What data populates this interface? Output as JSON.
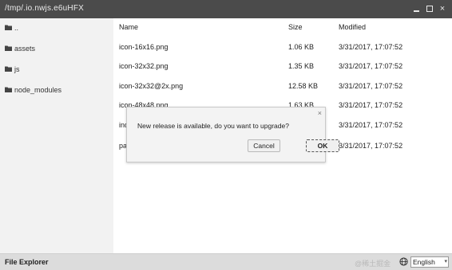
{
  "window": {
    "title": "/tmp/.io.nwjs.e6uHFX",
    "minimize_label": "",
    "maximize_label": "",
    "close_label": "×"
  },
  "sidebar": {
    "items": [
      {
        "label": ".."
      },
      {
        "label": "assets"
      },
      {
        "label": "js"
      },
      {
        "label": "node_modules"
      }
    ]
  },
  "table": {
    "columns": {
      "name": "Name",
      "size": "Size",
      "modified": "Modified"
    },
    "rows": [
      {
        "name": "icon-16x16.png",
        "size": "1.06 KB",
        "modified": "3/31/2017, 17:07:52"
      },
      {
        "name": "icon-32x32.png",
        "size": "1.35 KB",
        "modified": "3/31/2017, 17:07:52"
      },
      {
        "name": "icon-32x32@2x.png",
        "size": "12.58 KB",
        "modified": "3/31/2017, 17:07:52"
      },
      {
        "name": "icon-48x48.png",
        "size": "1.63 KB",
        "modified": "3/31/2017, 17:07:52"
      },
      {
        "name": "ind",
        "size": "",
        "modified": "3/31/2017, 17:07:52"
      },
      {
        "name": "pa",
        "size": "",
        "modified": "3/31/2017, 17:07:52"
      }
    ]
  },
  "dialog": {
    "close_label": "×",
    "message": "New release is available, do you want to upgrade?",
    "cancel_label": "Cancel",
    "ok_label": "OK"
  },
  "statusbar": {
    "title": "File Explorer",
    "watermark": "@稀土掘金",
    "language": "English"
  }
}
